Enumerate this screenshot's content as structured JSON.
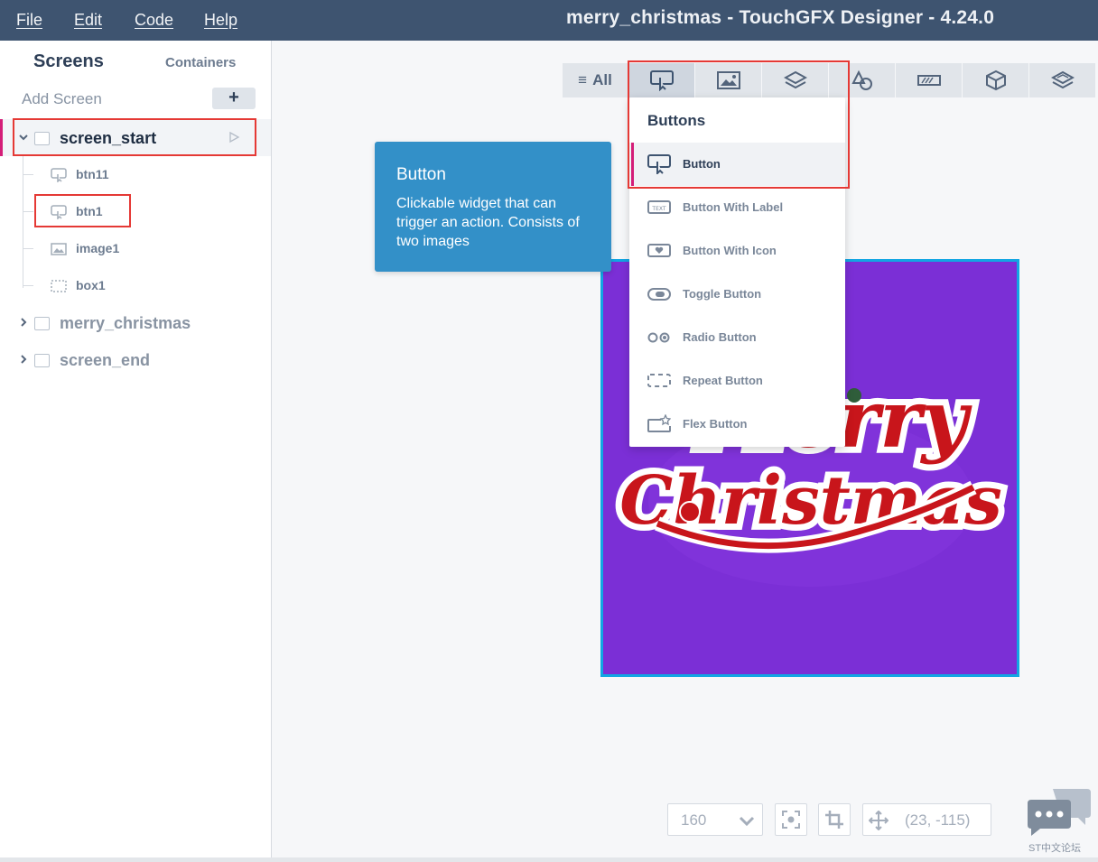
{
  "menu": {
    "file": "File",
    "edit": "Edit",
    "code": "Code",
    "help": "Help"
  },
  "app_title": "merry_christmas - TouchGFX Designer - 4.24.0",
  "left_panel": {
    "tab_screens": "Screens",
    "tab_containers": "Containers",
    "add_screen": "Add Screen",
    "add_button": "+",
    "screens": [
      {
        "name": "screen_start",
        "expanded": true
      },
      {
        "name": "merry_christmas",
        "expanded": false
      },
      {
        "name": "screen_end",
        "expanded": false
      }
    ],
    "widgets": [
      {
        "name": "btn11",
        "icon": "button-icon"
      },
      {
        "name": "btn1",
        "icon": "button-icon"
      },
      {
        "name": "image1",
        "icon": "image-icon"
      },
      {
        "name": "box1",
        "icon": "box-icon"
      }
    ]
  },
  "toolbar": {
    "all_label": "All",
    "tabs": [
      "buttons-icon",
      "image-icon",
      "layers-icon",
      "shapes-icon",
      "progress-icon",
      "3d-cube-icon",
      "containers-icon"
    ]
  },
  "tooltip": {
    "title": "Button",
    "description": "Clickable widget that can trigger an action. Consists of two images"
  },
  "dropdown": {
    "heading": "Buttons",
    "items": [
      {
        "label": "Button",
        "icon": "button-icon",
        "selected": true
      },
      {
        "label": "Button With Label",
        "icon": "text-button-icon",
        "selected": false
      },
      {
        "label": "Button With Icon",
        "icon": "heart-button-icon",
        "selected": false
      },
      {
        "label": "Toggle Button",
        "icon": "toggle-icon",
        "selected": false
      },
      {
        "label": "Radio Button",
        "icon": "radio-icon",
        "selected": false
      },
      {
        "label": "Repeat Button",
        "icon": "repeat-button-icon",
        "selected": false
      },
      {
        "label": "Flex Button",
        "icon": "flex-button-icon",
        "selected": false
      }
    ]
  },
  "preview": {
    "background_color": "#7b2fd6",
    "border_color": "#12a6e3",
    "image_text_line1": "Merry",
    "image_text_line2": "Christmas"
  },
  "bottom_bar": {
    "zoom": "160",
    "coordinates": "(23, -115)"
  },
  "watermark": "ST中文论坛",
  "colors": {
    "titlebar": "#3e5470",
    "accent": "#d41e78",
    "highlight_red": "#e53935",
    "tooltip": "#3390c8"
  }
}
